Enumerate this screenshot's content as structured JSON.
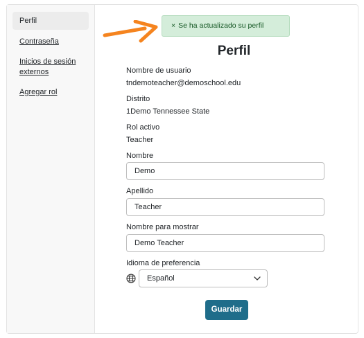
{
  "sidebar": {
    "items": [
      {
        "label": "Perfil"
      },
      {
        "label": "Contraseña"
      },
      {
        "label": "Inicios de sesión externos"
      },
      {
        "label": "Agregar rol"
      }
    ]
  },
  "toast": {
    "close_symbol": "×",
    "message": "Se ha actualizado su perfil"
  },
  "page": {
    "title": "Perfil"
  },
  "fields": {
    "username_label": "Nombre de usuario",
    "username_value": "tndemoteacher@demoschool.edu",
    "district_label": "Distrito",
    "district_value": "1Demo Tennessee State",
    "role_label": "Rol activo",
    "role_value": "Teacher",
    "first_name_label": "Nombre",
    "first_name_value": "Demo",
    "last_name_label": "Apellido",
    "last_name_value": "Teacher",
    "display_name_label": "Nombre para mostrar",
    "display_name_value": "Demo Teacher",
    "language_label": "Idioma de preferencia",
    "language_value": "Español"
  },
  "actions": {
    "save_label": "Guardar"
  },
  "colors": {
    "accent": "#1f6d8a",
    "success_bg": "#d4edda",
    "annotation_arrow": "#f5841f"
  },
  "icons": {
    "globe": "globe-icon",
    "chevron": "chevron-down-icon",
    "arrow": "arrow-right-icon"
  }
}
